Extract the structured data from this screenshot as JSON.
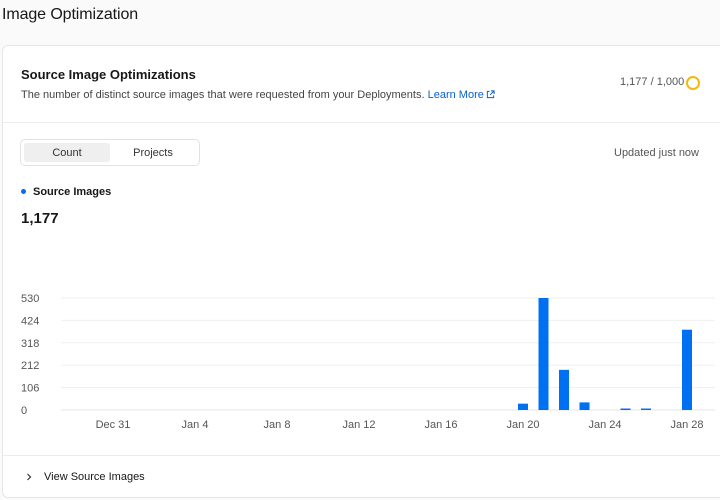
{
  "page": {
    "title": "Image Optimization"
  },
  "card": {
    "title": "Source Image Optimizations",
    "description": "The number of distinct source images that were requested from your Deployments.",
    "learn_more": "Learn More",
    "usage": "1,177 / 1,000"
  },
  "toggle": {
    "count_label": "Count",
    "projects_label": "Projects",
    "active": "count"
  },
  "status": {
    "updated": "Updated just now"
  },
  "legend": {
    "series_name": "Source Images",
    "total": "1,177"
  },
  "footer": {
    "view_label": "View Source Images"
  },
  "colors": {
    "accent": "#0070f3",
    "link": "#0761d1",
    "usage_ring": "#f5b90a"
  },
  "icons": {
    "external": "external-link-icon",
    "chevron": "chevron-right-icon"
  },
  "chart_data": {
    "type": "bar",
    "title": "",
    "xlabel": "",
    "ylabel": "",
    "ylim": [
      0,
      530
    ],
    "y_ticks": [
      "530",
      "424",
      "318",
      "212",
      "106",
      "0"
    ],
    "y_tick_values": [
      530,
      424,
      318,
      212,
      106,
      0
    ],
    "x_tick_labels": [
      "Dec 31",
      "Jan 4",
      "Jan 8",
      "Jan 12",
      "Jan 16",
      "Jan 20",
      "Jan 24",
      "Jan 28"
    ],
    "x_tick_indices": [
      2,
      6,
      10,
      14,
      18,
      22,
      26,
      30
    ],
    "grid": true,
    "series": [
      {
        "name": "Source Images",
        "values": [
          0,
          0,
          0,
          0,
          0,
          0,
          0,
          0,
          0,
          0,
          0,
          0,
          0,
          0,
          0,
          0,
          0,
          0,
          0,
          0,
          0,
          0,
          30,
          530,
          190,
          36,
          0,
          4,
          3,
          0,
          380
        ]
      }
    ]
  }
}
